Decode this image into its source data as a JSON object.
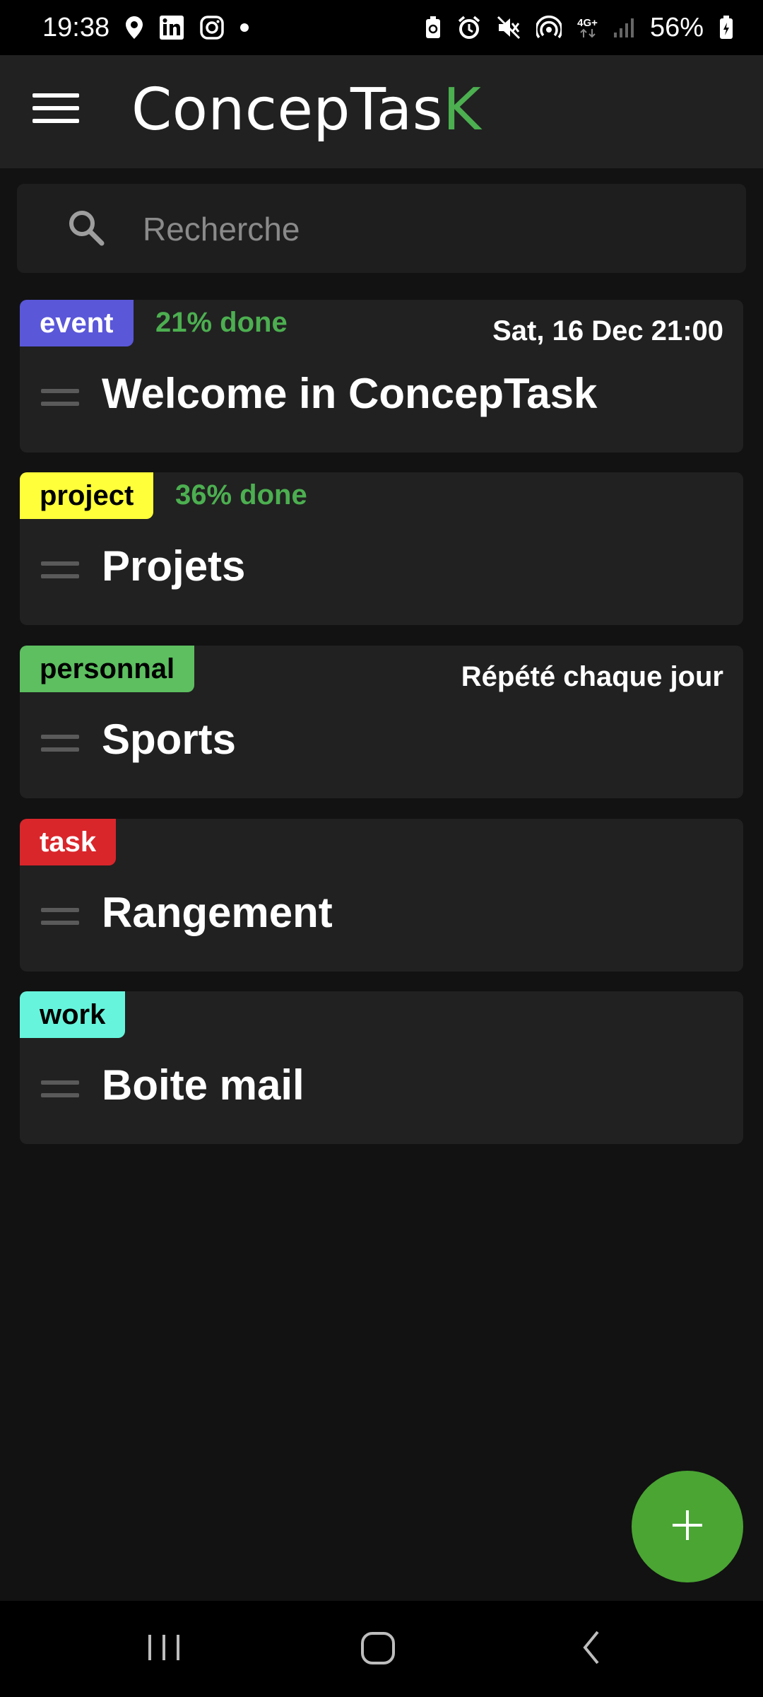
{
  "status_bar": {
    "time": "19:38",
    "battery": "56%",
    "network": "4G+",
    "left_icons": [
      "location-icon",
      "linkedin-icon",
      "instagram-icon",
      "dot-icon"
    ],
    "right_icons": [
      "battery-saver-icon",
      "alarm-icon",
      "mute-icon",
      "hotspot-icon",
      "network-4g-icon",
      "signal-icon",
      "battery-icon"
    ]
  },
  "app_bar": {
    "title_main": "ConcepTas",
    "title_accent": "K",
    "menu_icon": "hamburger-icon"
  },
  "search": {
    "placeholder": "Recherche",
    "value": "",
    "icon": "search-icon"
  },
  "tasks": [
    {
      "tag": "event",
      "tag_color": "#5a57d9",
      "tag_text_color": "#ffffff",
      "progress": "21% done",
      "meta": "Sat, 16 Dec 21:00",
      "title": "Welcome in ConcepTask"
    },
    {
      "tag": "project",
      "tag_color": "#ffff3a",
      "tag_text_color": "#000000",
      "progress": "36% done",
      "meta": "",
      "title": "Projets"
    },
    {
      "tag": "personnal",
      "tag_color": "#5dbf60",
      "tag_text_color": "#000000",
      "progress": "",
      "meta": "Répété chaque jour",
      "title": "Sports"
    },
    {
      "tag": "task",
      "tag_color": "#d9262b",
      "tag_text_color": "#ffffff",
      "progress": "",
      "meta": "",
      "title": "Rangement"
    },
    {
      "tag": "work",
      "tag_color": "#66f5dc",
      "tag_text_color": "#000000",
      "progress": "",
      "meta": "",
      "title": "Boite mail"
    }
  ],
  "colors": {
    "background": "#121212",
    "card": "#212121",
    "accent": "#4caf50",
    "fab": "#4aa533"
  },
  "fab": {
    "icon": "plus-icon"
  },
  "nav_bar": {
    "icons": [
      "recents-icon",
      "home-icon",
      "back-icon"
    ]
  }
}
